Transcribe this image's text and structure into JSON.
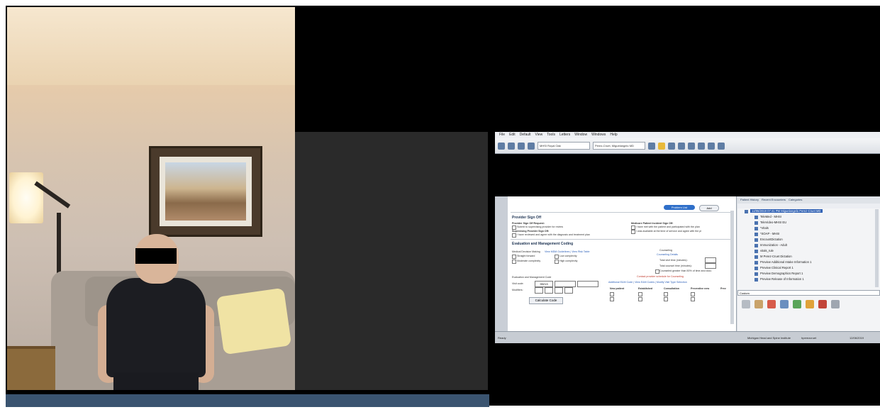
{
  "emr": {
    "menu": [
      "File",
      "Edit",
      "Default",
      "View",
      "Tools",
      "Letters",
      "Window",
      "Windows",
      "Help"
    ],
    "toolbar": {
      "location_select": "MHSI Royal Oak",
      "provider_select": "Perez-Cruet, Miguelangelo MD"
    },
    "form": {
      "buttons": {
        "problem": "Problem List",
        "add": "Add",
        "calculate": "Calculate Code"
      },
      "provider_signoff": {
        "heading": "Provider Sign Off",
        "signoff_request": "Provider Sign Off Request:",
        "submit_supervising": "Submit to supervising provider for review",
        "supervising_signoff": "Supervising Provider Sign Off:",
        "reviewed_agree": "I have reviewed and agree with the diagnosis and treatment plan",
        "medicare_signoff": "Medicare Patient Incident Sign Off:",
        "saw_patient": "I have met with the patient and participated with the plan",
        "available": "I was available at the time of service and agree with the pl"
      },
      "em_coding": {
        "heading": "Evaluation and Management Coding",
        "mdm_label": "Medical Decision Making",
        "mdm_links": "View MDM Guidelines  |  View Risk Table",
        "mdm_options": [
          "Straight forward",
          "Low complexity",
          "Moderate complexity",
          "High complexity"
        ],
        "counseling_label": "Counseling",
        "counseling_details": "Counseling Details",
        "total_visit_time": "Total visit time (minutes):",
        "total_counsel_time": "Total counsel time (minutes):",
        "counseled_greater": "Counseled greater than 50% of time and docu",
        "warning": "Contact provider schedule for Counseling",
        "em_code_label": "Evaluation and Management Code",
        "visit_code_label": "Visit code:",
        "modifiers_label": "Modifiers:",
        "code_links": "Additional E&M Code  |  View E&M Codes  |  Modify Visit Type Selection",
        "columns": [
          "New patient",
          "Established",
          "Consultation",
          "Preventive new",
          "Prev"
        ],
        "visit_code_value": "99213"
      }
    },
    "side": {
      "tabs": [
        "Patient History",
        "Recent Encounters",
        "Categories"
      ],
      "tree": [
        {
          "label": "12/06/2019 07:41 PM  Miguelangelo Perez-Cruet MD",
          "selected": true
        },
        {
          "label": "TeleMed - MHSI",
          "selected": false
        },
        {
          "label": "TeleVideo-MHSI EU",
          "selected": false
        },
        {
          "label": "*Vitals",
          "selected": false
        },
        {
          "label": "*SOAP - MHSI",
          "selected": false
        },
        {
          "label": "EncountDictation",
          "selected": false
        },
        {
          "label": "Immunization - Adult",
          "selected": false
        },
        {
          "label": "vitals_rule",
          "selected": false
        },
        {
          "label": "M Perez-Cruet Dictation",
          "selected": false
        },
        {
          "label": "Preview Additional Intake Information 1",
          "selected": false
        },
        {
          "label": "Preview Clinical Report 1",
          "selected": false
        },
        {
          "label": "Preview Demographics Report 1",
          "selected": false
        },
        {
          "label": "Preview Release of Information 1",
          "selected": false
        }
      ],
      "custom": "Custom"
    },
    "status": {
      "left": "Ready",
      "practice": "Michigan Head and Spine Institute",
      "user": "hperezcruet",
      "date": "12/06/2019"
    }
  }
}
